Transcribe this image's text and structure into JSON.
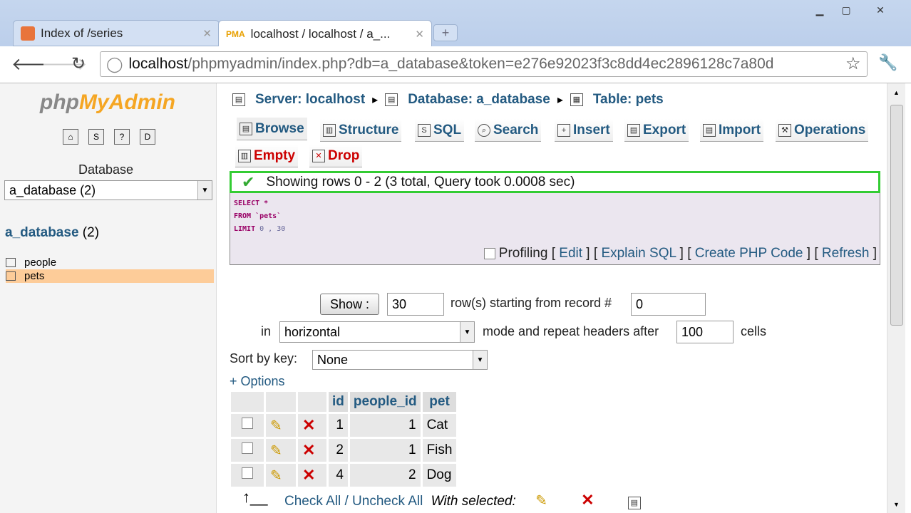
{
  "browser": {
    "tabs": [
      {
        "title": "Index of /series"
      },
      {
        "title": "localhost / localhost / a_..."
      }
    ],
    "url_host": "localhost",
    "url_rest": "/phpmyadmin/index.php?db=a_database&token=e276e92023f3c8dd4ec2896128c7a80d"
  },
  "sidebar": {
    "logo": "phpMyAdmin",
    "database_label": "Database",
    "database_select": "a_database (2)",
    "db_name": "a_database",
    "db_count": "(2)",
    "tables": [
      "people",
      "pets"
    ]
  },
  "breadcrumb": {
    "server": "Server: localhost",
    "database": "Database: a_database",
    "table": "Table: pets"
  },
  "tabs": [
    "Browse",
    "Structure",
    "SQL",
    "Search",
    "Insert",
    "Export",
    "Import",
    "Operations",
    "Empty",
    "Drop"
  ],
  "message": "Showing rows 0 - 2 (3 total, Query took 0.0008 sec)",
  "sql": {
    "line1": "SELECT *",
    "line2": "FROM `pets`",
    "line3_kw": "LIMIT",
    "line3_val": "0 , 30"
  },
  "sql_links": {
    "profiling": "Profiling",
    "edit": "Edit",
    "explain": "Explain SQL",
    "php": "Create PHP Code",
    "refresh": "Refresh"
  },
  "nav_form": {
    "show_button": "Show :",
    "rows": "30",
    "starting_label": "row(s) starting from record #",
    "start": "0",
    "in_label": "in",
    "mode": "horizontal",
    "repeat_label": "mode and repeat headers after",
    "repeat": "100",
    "cells_label": "cells",
    "sort_label": "Sort by key:",
    "sort": "None",
    "options": "+ Options"
  },
  "table": {
    "columns": [
      "id",
      "people_id",
      "pet"
    ],
    "rows": [
      [
        "1",
        "1",
        "Cat"
      ],
      [
        "2",
        "1",
        "Fish"
      ],
      [
        "4",
        "2",
        "Dog"
      ]
    ]
  },
  "footer": {
    "check_all": "Check All",
    "separator": " / ",
    "uncheck_all": "Uncheck All",
    "with_selected": "With selected:"
  }
}
